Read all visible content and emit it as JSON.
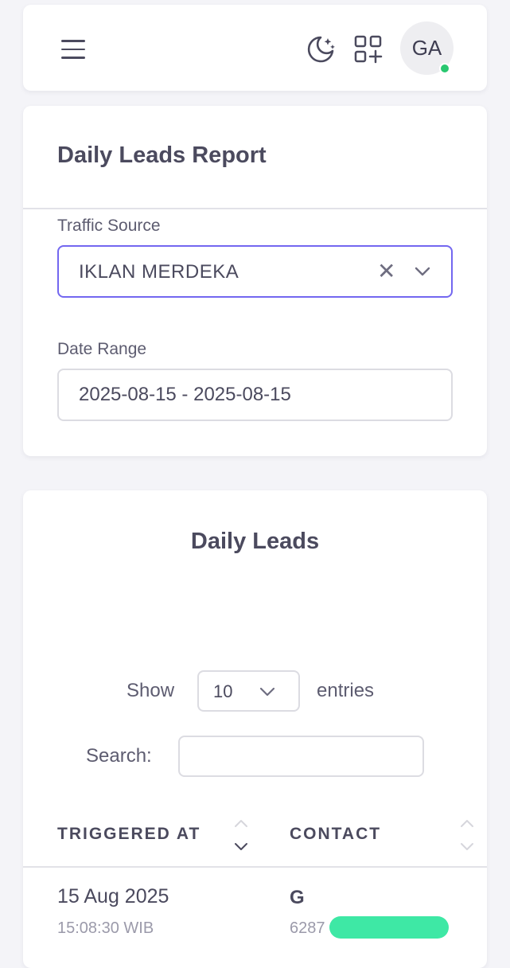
{
  "navbar": {
    "menu_icon": "hamburger-menu-icon",
    "theme_icon": "moon-stars-icon",
    "apps_icon": "grid-plus-icon",
    "avatar_initials": "GA",
    "status_color": "#28c76f"
  },
  "report": {
    "title": "Daily Leads Report",
    "traffic_source": {
      "label": "Traffic Source",
      "value": "IKLAN MERDEKA",
      "clear_icon": "close-icon",
      "chevron_icon": "chevron-down-icon"
    },
    "date_range": {
      "label": "Date Range",
      "value": "2025-08-15 - 2025-08-15"
    }
  },
  "leads": {
    "title": "Daily Leads",
    "show_label": "Show",
    "page_length": "10",
    "entries_label": "entries",
    "search_label": "Search:",
    "search_value": "",
    "columns": [
      "TRIGGERED AT",
      "CONTACT"
    ],
    "rows": [
      {
        "date": "15 Aug 2025",
        "time": "15:08:30 WIB",
        "contact_name": "G",
        "contact_phone": "6287"
      }
    ]
  },
  "colors": {
    "accent": "#7367f0",
    "redaction": "#3ee8a5"
  }
}
